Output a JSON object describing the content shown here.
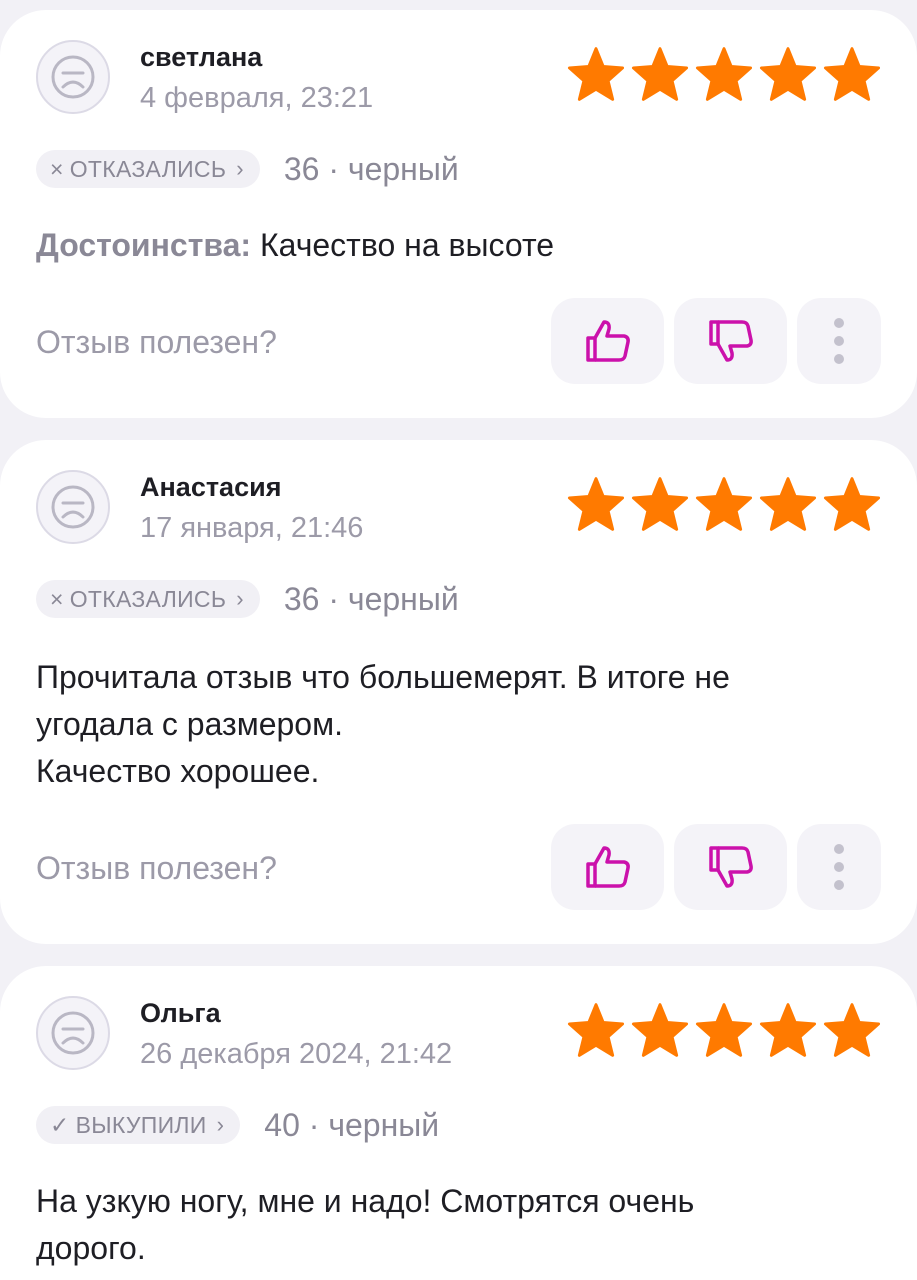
{
  "reviews": [
    {
      "author": "светлана",
      "date": "4 февраля, 23:21",
      "rating": 5,
      "status": {
        "mark": "×",
        "label": "ОТКАЗАЛИСЬ",
        "chevron": "›"
      },
      "size_color": "36 · черный",
      "text_label": "Достоинства:",
      "text": "Качество на высоте",
      "helpful_prompt": "Отзыв полезен?"
    },
    {
      "author": "Анастасия",
      "date": "17 января, 21:46",
      "rating": 5,
      "status": {
        "mark": "×",
        "label": "ОТКАЗАЛИСЬ",
        "chevron": "›"
      },
      "size_color": "36 · черный",
      "text_line1": "Прочитала отзыв что большемерят. В итоге не",
      "text_line2": "угодала с размером.",
      "text_line3": "Качество хорошее.",
      "helpful_prompt": "Отзыв полезен?"
    },
    {
      "author": "Ольга",
      "date": "26 декабря 2024, 21:42",
      "rating": 5,
      "status": {
        "mark": "✓",
        "label": "ВЫКУПИЛИ",
        "chevron": "›"
      },
      "size_color": "40 · черный",
      "text_line1": "На узкую ногу, мне и надо! Смотрятся очень",
      "text_line2": "дорого."
    }
  ],
  "colors": {
    "star": "#ff7a00",
    "thumb": "#cb11ab",
    "muted": "#9c9aa8",
    "background": "#f2f1f6"
  },
  "icons": [
    "sad-face-avatar-icon",
    "star-icon",
    "thumbs-up-icon",
    "thumbs-down-icon",
    "more-vertical-icon"
  ]
}
